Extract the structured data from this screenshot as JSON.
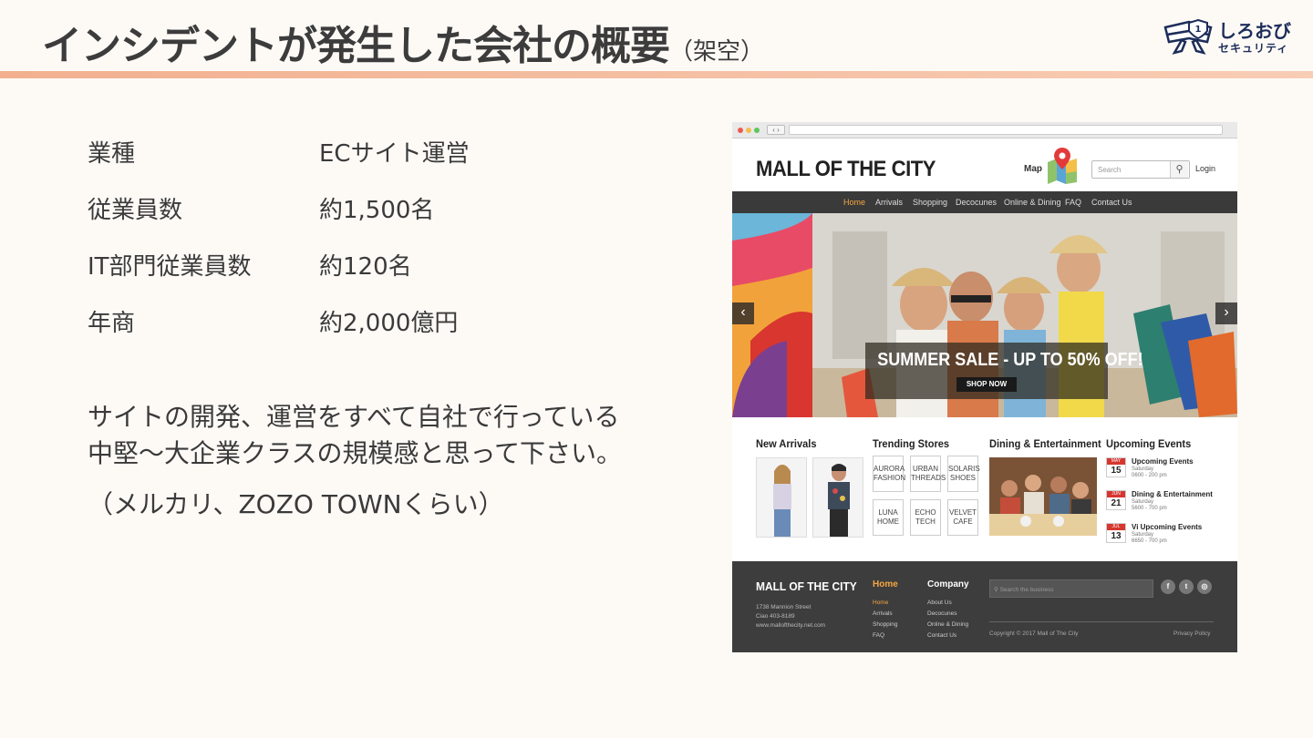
{
  "slide": {
    "title": "インシデントが発生した会社の概要",
    "title_suffix": "（架空）",
    "logo": {
      "line1": "しろおび",
      "line2": "セキュリティ",
      "badge": "1"
    }
  },
  "company": {
    "rows": [
      {
        "label": "業種",
        "value": "ECサイト運営"
      },
      {
        "label": "従業員数",
        "value": "約1,500名"
      },
      {
        "label": "IT部門従業員数",
        "value": "約120名"
      },
      {
        "label": "年商",
        "value": "約2,000億円"
      }
    ],
    "description": [
      "サイトの開発、運営をすべて自社で行っている",
      "中堅～大企業クラスの規模感と思って下さい。"
    ],
    "note": "（メルカリ、ZOZO TOWNくらい）"
  },
  "mockup": {
    "browser_nav": "‹ ›",
    "site_name": "MALL OF THE CITY",
    "map_label": "Map",
    "search_placeholder": "Search",
    "search_icon": "search-icon",
    "login": "Login",
    "nav": [
      "Home",
      "Arrivals",
      "Shopping",
      "Decocunes",
      "Online & Dining",
      "FAQ",
      "Contact Us"
    ],
    "hero": {
      "headline": "SUMMER SALE - UP TO 50% OFF!",
      "button": "SHOP NOW",
      "prev": "‹",
      "next": "›"
    },
    "sections": {
      "new_arrivals": "New Arrivals",
      "trending": "Trending Stores",
      "dining": "Dining & Entertainment",
      "events": "Upcoming Events"
    },
    "stores": [
      [
        "AURORA",
        "FASHION"
      ],
      [
        "URBAN",
        "THREADS"
      ],
      [
        "SOLARIS",
        "SHOES"
      ],
      [
        "LUNA",
        "HOME"
      ],
      [
        "ECHO",
        "TECH"
      ],
      [
        "VELVET",
        "CAFE"
      ]
    ],
    "events": [
      {
        "month": "MAY",
        "day": "15",
        "title": "Upcoming Events",
        "sub1": "Saturday",
        "sub2": "0600 - 200 pm"
      },
      {
        "month": "JUN",
        "day": "21",
        "title": "Dining & Entertainment",
        "sub1": "Saturday",
        "sub2": "5600 - 700 pm"
      },
      {
        "month": "JUL",
        "day": "13",
        "title": "Vi Upcoming Events",
        "sub1": "Saturday",
        "sub2": "6650 - 700 pm"
      }
    ],
    "footer": {
      "site_name": "MALL OF THE CITY",
      "address": [
        "1738 Mannion Street",
        "Ciao 403-8189",
        "www.mallofthecity.net.com"
      ],
      "col1_title": "Home",
      "col1_links": [
        "Home",
        "Arrivals",
        "Shopping",
        "FAQ"
      ],
      "col2_title": "Company",
      "col2_links": [
        "About Us",
        "Decocunes",
        "Online & Dining",
        "Contact Us"
      ],
      "search_placeholder": "Search the business",
      "copyright": "Copyright © 2017 Mall of The City",
      "legal": "Privacy  Policy",
      "social": [
        "f",
        "t",
        "◎"
      ]
    }
  },
  "colors": {
    "accent_rule": "#f2b08f",
    "nav_active": "#f5a742",
    "logo_navy": "#1d2d5a"
  }
}
